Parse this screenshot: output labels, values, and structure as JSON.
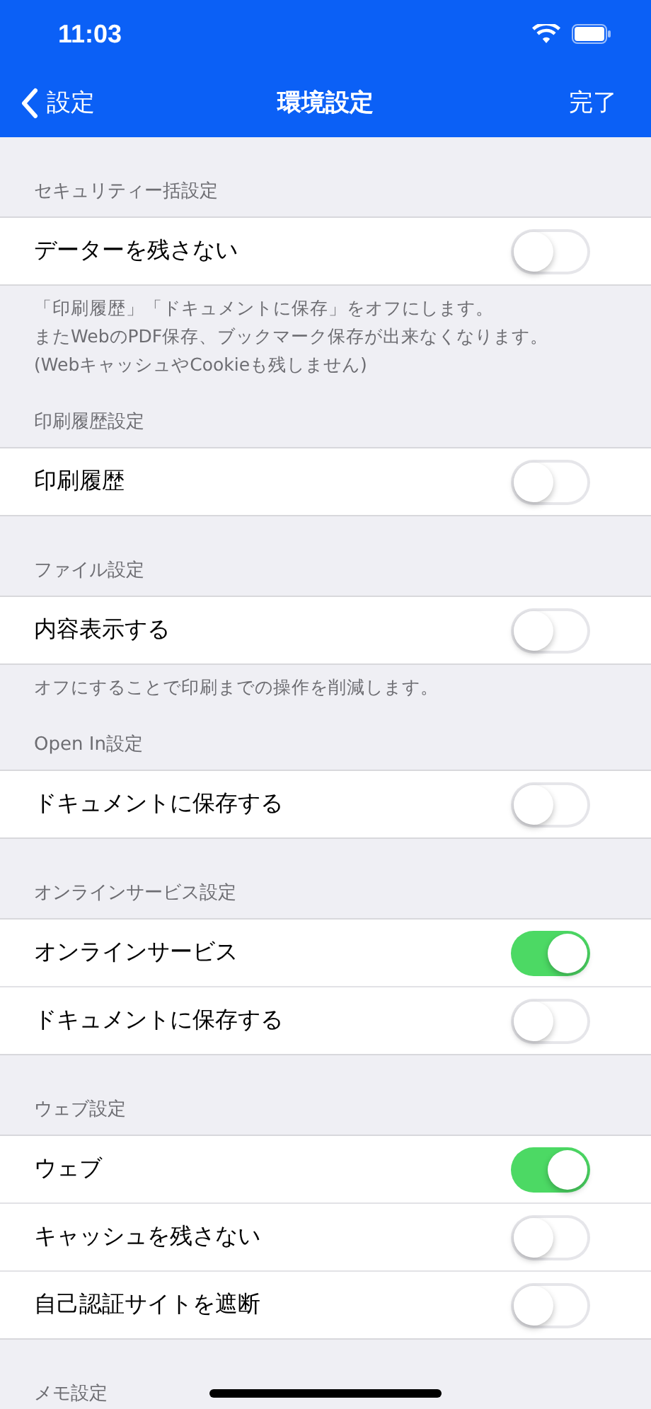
{
  "status_bar": {
    "time": "11:03"
  },
  "nav": {
    "back": "設定",
    "title": "環境設定",
    "done": "完了"
  },
  "sections": [
    {
      "header": "セキュリティー括設定",
      "rows": [
        {
          "label": "データーを残さない",
          "on": false
        }
      ],
      "footer": [
        "「印刷履歴」「ドキュメントに保存」をオフにします。",
        "またWebのPDF保存、ブックマーク保存が出来なくなります。",
        "(WebキャッシュやCookieも残しません)"
      ]
    },
    {
      "header": "印刷履歴設定",
      "rows": [
        {
          "label": "印刷履歴",
          "on": false
        }
      ]
    },
    {
      "header": "ファイル設定",
      "rows": [
        {
          "label": "内容表示する",
          "on": false
        }
      ],
      "footer": [
        "オフにすることで印刷までの操作を削減します。"
      ]
    },
    {
      "header": "Open In設定",
      "rows": [
        {
          "label": "ドキュメントに保存する",
          "on": false
        }
      ]
    },
    {
      "header": "オンラインサービス設定",
      "rows": [
        {
          "label": "オンラインサービス",
          "on": true
        },
        {
          "label": "ドキュメントに保存する",
          "on": false
        }
      ]
    },
    {
      "header": "ウェブ設定",
      "rows": [
        {
          "label": "ウェブ",
          "on": true
        },
        {
          "label": "キャッシュを残さない",
          "on": false
        },
        {
          "label": "自己認証サイトを遮断",
          "on": false
        }
      ]
    },
    {
      "header": "メモ設定"
    }
  ]
}
